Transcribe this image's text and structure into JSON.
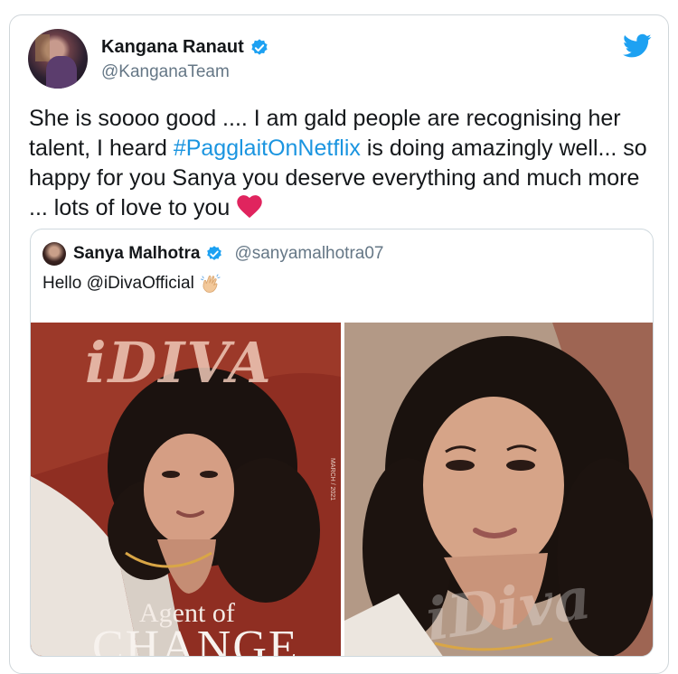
{
  "tweet": {
    "author_name": "Kangana Ranaut",
    "author_handle": "@KanganaTeam",
    "text_part1": "She is soooo good .... I am gald people are recognising her talent, I heard ",
    "hashtag": "#PagglaitOnNetflix",
    "text_part2": " is doing amazingly well... so happy for you Sanya you deserve everything and much more ... lots of love to you "
  },
  "quoted_tweet": {
    "author_name": "Sanya Malhotra",
    "author_handle": "@sanyamalhotra07",
    "text": "Hello @iDivaOfficial",
    "images": [
      {
        "cover_logo": "iDIVA",
        "cover_subtitle": "Agent of",
        "cover_headline": "CHANGE",
        "cover_date": "MARCH / 2021"
      },
      {
        "watermark": "iDiva"
      }
    ]
  },
  "colors": {
    "link": "#1b95e0",
    "verified": "#1da1f2",
    "twitter_brand": "#1da1f2",
    "heart": "#e0245e"
  },
  "icons": [
    "verified-badge-icon",
    "twitter-logo-icon",
    "red-heart-icon",
    "waving-hand-icon"
  ]
}
